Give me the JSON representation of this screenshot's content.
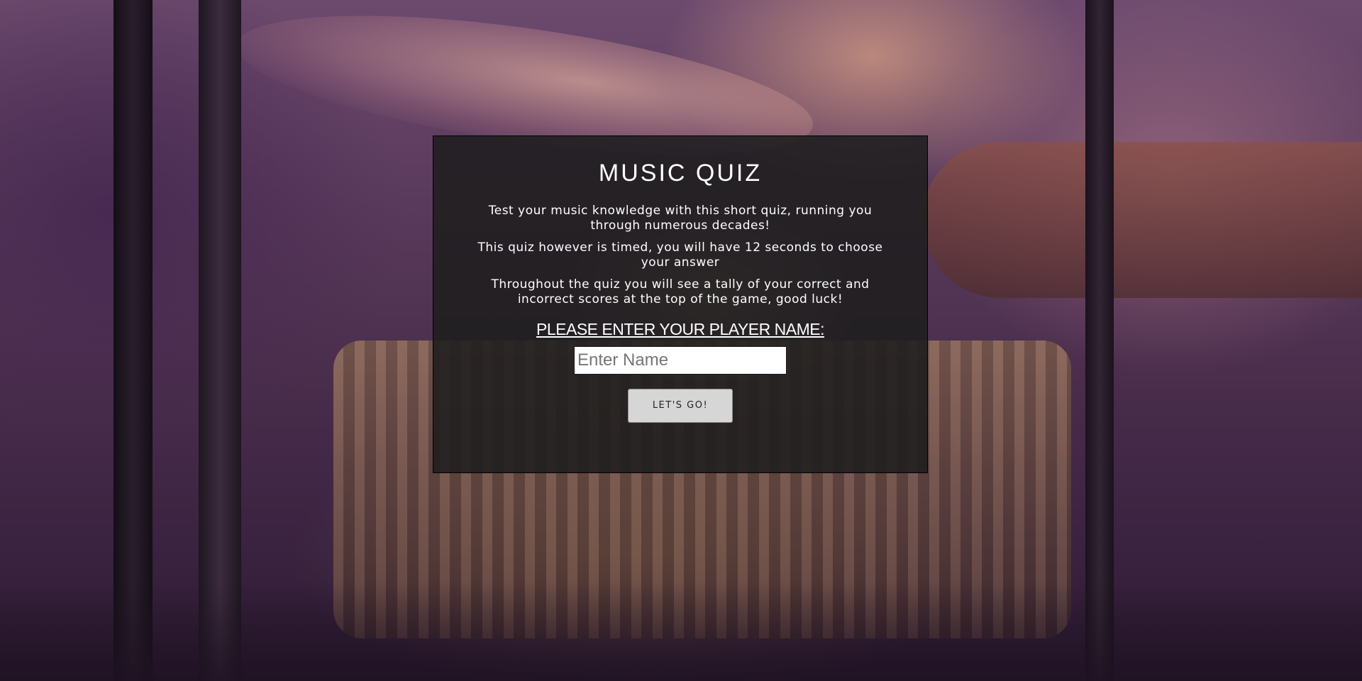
{
  "quiz": {
    "title": "MUSIC QUIZ",
    "intro": [
      "Test your music knowledge with this short quiz, running you through numerous decades!",
      "This quiz however is timed, you will have 12 seconds to choose your answer",
      "Throughout the quiz you will see a tally of your correct and incorrect scores at the top of the game, good luck!"
    ],
    "name_heading": "PLEASE ENTER YOUR PLAYER NAME:",
    "name_input": {
      "placeholder": "Enter Name",
      "value": ""
    },
    "start_button": "LET'S GO!"
  },
  "colors": {
    "panel_background": "#1e1e1e",
    "text": "#ffffff",
    "button_background": "#d6d6d6"
  }
}
